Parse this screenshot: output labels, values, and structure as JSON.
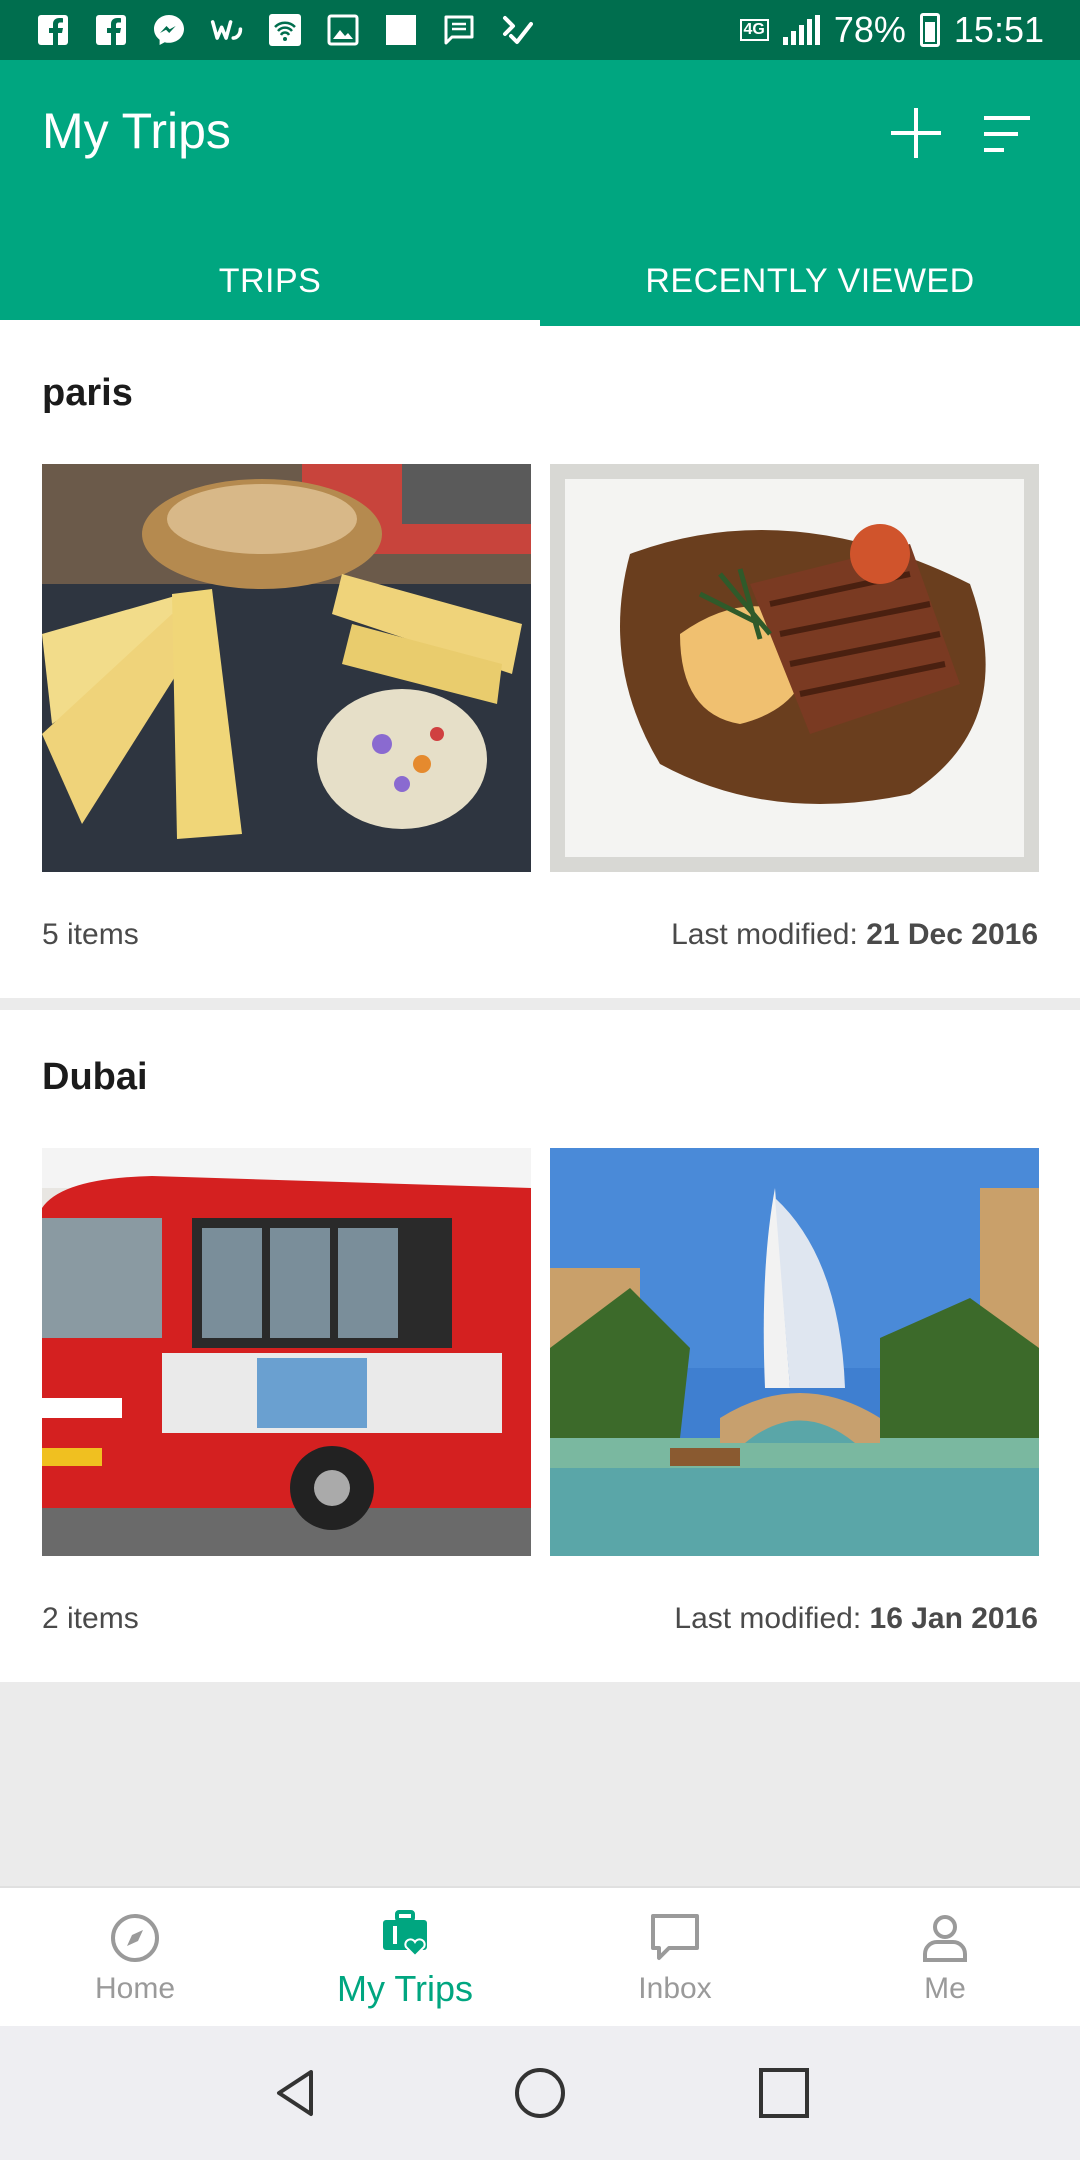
{
  "status_bar": {
    "network": "4G",
    "battery": "78%",
    "time": "15:51",
    "icons": [
      "facebook-icon",
      "facebook-icon",
      "messenger-icon",
      "wattpad-icon",
      "wifi-hotspot-icon",
      "gallery-icon",
      "notification-square-icon",
      "message-icon",
      "check-icon"
    ]
  },
  "app_bar": {
    "title": "My Trips",
    "actions": [
      "add-icon",
      "sort-icon"
    ]
  },
  "tabs": [
    {
      "label": "TRIPS",
      "active": true
    },
    {
      "label": "RECENTLY VIEWED",
      "active": false
    }
  ],
  "trips": [
    {
      "name": "paris",
      "photos": [
        "cheese-platter-photo",
        "steak-dish-photo"
      ],
      "items": "5 items",
      "modified_label": "Last modified:",
      "modified_date": "21 Dec 2016"
    },
    {
      "name": "Dubai",
      "photos": [
        "red-tour-bus-photo",
        "burj-al-arab-photo"
      ],
      "items": "2 items",
      "modified_label": "Last modified:",
      "modified_date": "16 Jan 2016"
    }
  ],
  "bottom_nav": [
    {
      "label": "Home",
      "icon": "compass-icon",
      "active": false
    },
    {
      "label": "My Trips",
      "icon": "suitcase-heart-icon",
      "active": true
    },
    {
      "label": "Inbox",
      "icon": "chat-bubble-icon",
      "active": false
    },
    {
      "label": "Me",
      "icon": "person-icon",
      "active": false
    }
  ],
  "colors": {
    "status_bar": "#006e4e",
    "brand": "#00a680",
    "background": "#ebebeb"
  }
}
